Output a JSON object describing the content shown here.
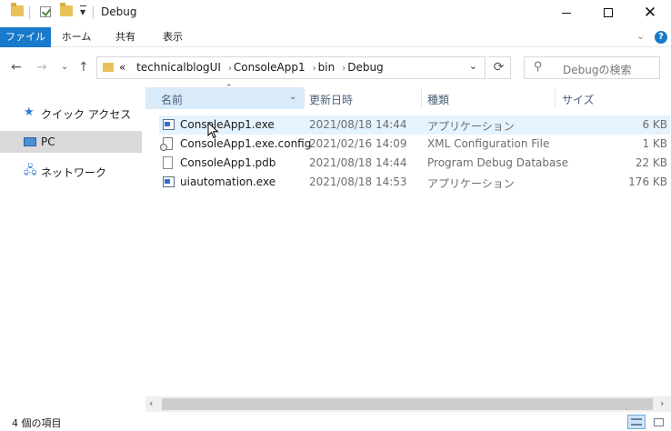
{
  "window": {
    "title": "Debug"
  },
  "ribbon": {
    "tabs": [
      "ファイル",
      "ホーム",
      "共有",
      "表示"
    ]
  },
  "address": {
    "overflow": "«",
    "crumbs": [
      "technicalblogUI",
      "ConsoleApp1",
      "bin",
      "Debug"
    ]
  },
  "search": {
    "placeholder": "Debugの検索"
  },
  "nav_pane": {
    "items": [
      {
        "label": "クイック アクセス",
        "icon": "star-icon"
      },
      {
        "label": "PC",
        "icon": "computer-icon",
        "selected": true
      },
      {
        "label": "ネットワーク",
        "icon": "network-icon"
      }
    ]
  },
  "columns": {
    "name": "名前",
    "date": "更新日時",
    "type": "種類",
    "size": "サイズ"
  },
  "files": [
    {
      "name": "ConsoleApp1.exe",
      "date": "2021/08/18 14:44",
      "type": "アプリケーション",
      "size": "6 KB",
      "icon": "exe-icon"
    },
    {
      "name": "ConsoleApp1.exe.config",
      "date": "2021/02/16 14:09",
      "type": "XML Configuration File",
      "size": "1 KB",
      "icon": "config-file-icon"
    },
    {
      "name": "ConsoleApp1.pdb",
      "date": "2021/08/18 14:44",
      "type": "Program Debug Database",
      "size": "22 KB",
      "icon": "file-icon"
    },
    {
      "name": "uiautomation.exe",
      "date": "2021/08/18 14:53",
      "type": "アプリケーション",
      "size": "176 KB",
      "icon": "exe-icon"
    }
  ],
  "status": {
    "count": "4 個の項目"
  },
  "colors": {
    "accent": "#1979ca",
    "selection": "#d9d9d9",
    "hover": "#e5f3ff"
  }
}
